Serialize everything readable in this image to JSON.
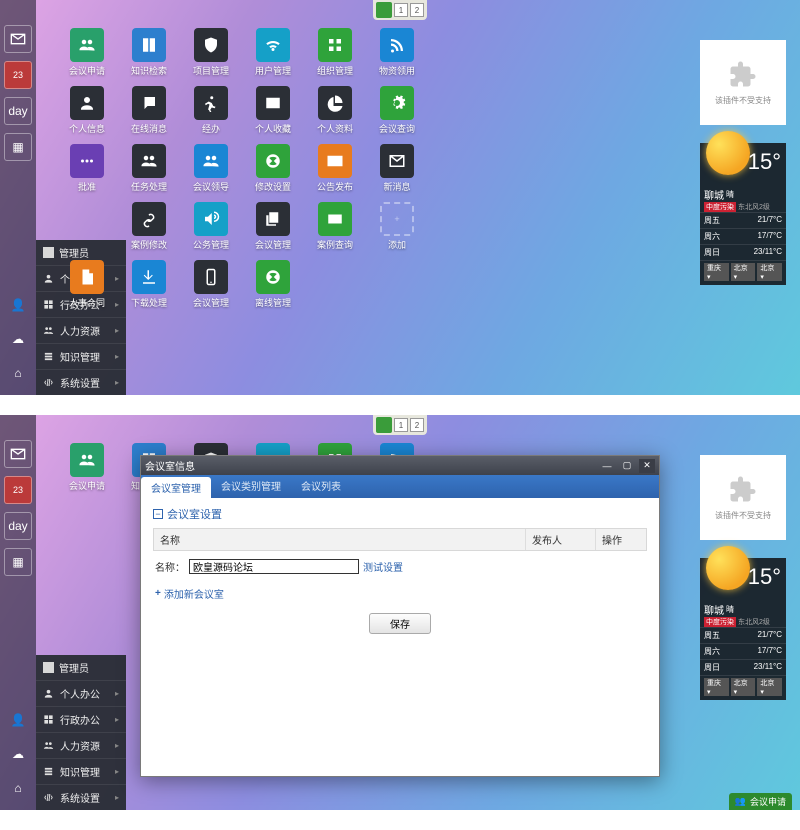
{
  "pager": {
    "pages": [
      "1",
      "2"
    ]
  },
  "rail": {
    "badge": "23",
    "day": "day"
  },
  "menu": {
    "header": "管理员",
    "items": [
      {
        "label": "个人办公"
      },
      {
        "label": "行政办公"
      },
      {
        "label": "人力资源"
      },
      {
        "label": "知识管理"
      },
      {
        "label": "系统设置"
      }
    ]
  },
  "tiles": [
    {
      "label": "会议申请",
      "bg": "#29a06b",
      "ic": "users"
    },
    {
      "label": "知识检索",
      "bg": "#2d7fce",
      "ic": "book"
    },
    {
      "label": "项目管理",
      "bg": "#2b2f36",
      "ic": "shield"
    },
    {
      "label": "用户管理",
      "bg": "#15a0c8",
      "ic": "wifi"
    },
    {
      "label": "组织管理",
      "bg": "#2fa33b",
      "ic": "org"
    },
    {
      "label": "物资领用",
      "bg": "#1a86d4",
      "ic": "rss"
    },
    {
      "label": "",
      "bg": "",
      "ic": ""
    },
    {
      "label": "个人信息",
      "bg": "#2b2f36",
      "ic": "user"
    },
    {
      "label": "在线消息",
      "bg": "#2b2f36",
      "ic": "chat"
    },
    {
      "label": "经办",
      "bg": "#2b2f36",
      "ic": "run"
    },
    {
      "label": "个人收藏",
      "bg": "#2b2f36",
      "ic": "card"
    },
    {
      "label": "个人资料",
      "bg": "#2b2f36",
      "ic": "pie"
    },
    {
      "label": "会议查询",
      "bg": "#2fa33b",
      "ic": "gear"
    },
    {
      "label": "",
      "bg": "",
      "ic": ""
    },
    {
      "label": "批准",
      "bg": "#6a3fb3",
      "ic": "dots"
    },
    {
      "label": "任务处理",
      "bg": "#2b2f36",
      "ic": "users"
    },
    {
      "label": "会议领导",
      "bg": "#1a86d4",
      "ic": "users"
    },
    {
      "label": "修改设置",
      "bg": "#2fa33b",
      "ic": "xbox"
    },
    {
      "label": "公告发布",
      "bg": "#e87b1e",
      "ic": "mail"
    },
    {
      "label": "新消息",
      "bg": "#2b2f36",
      "ic": "mailb"
    },
    {
      "label": "",
      "bg": "",
      "ic": ""
    },
    {
      "label": "",
      "bg": "",
      "ic": "clock"
    },
    {
      "label": "案例修改",
      "bg": "#2b2f36",
      "ic": "link"
    },
    {
      "label": "公务管理",
      "bg": "#15a0c8",
      "ic": "sound"
    },
    {
      "label": "会议管理",
      "bg": "#2b2f36",
      "ic": "copy"
    },
    {
      "label": "案例查询",
      "bg": "#2fa33b",
      "ic": "wallet"
    },
    {
      "label": "添加",
      "bg": "add",
      "ic": "plus"
    },
    {
      "label": "",
      "bg": "",
      "ic": ""
    },
    {
      "label": "人事合同",
      "bg": "#e87b1e",
      "ic": "doc"
    },
    {
      "label": "下载处理",
      "bg": "#1a86d4",
      "ic": "down"
    },
    {
      "label": "会议管理",
      "bg": "#2b2f36",
      "ic": "phone"
    },
    {
      "label": "离线管理",
      "bg": "#2fa33b",
      "ic": "xbox"
    }
  ],
  "widget": {
    "unsupported": "该插件不受支持",
    "city": "聊城",
    "cond": "晴",
    "air_label": "中度污染",
    "wind": "东北风2级",
    "temp": "15°",
    "days": [
      {
        "d": "周五",
        "t": "21/7°C"
      },
      {
        "d": "周六",
        "t": "17/7°C"
      },
      {
        "d": "周日",
        "t": "23/11°C"
      }
    ],
    "selects": [
      "重庆",
      "北京",
      "北京"
    ]
  },
  "dialog": {
    "title": "会议室信息",
    "tabs": [
      "会议室管理",
      "会议类别管理",
      "会议列表"
    ],
    "section": "会议室设置",
    "cols": {
      "name": "名称",
      "pub": "发布人",
      "op": "操作"
    },
    "form_label": "名称：",
    "form_value": "欧皇源码论坛",
    "test_link": "测试设置",
    "add_link": "添加新会议室",
    "save": "保存"
  },
  "taskbar": {
    "label": "会议申请"
  }
}
